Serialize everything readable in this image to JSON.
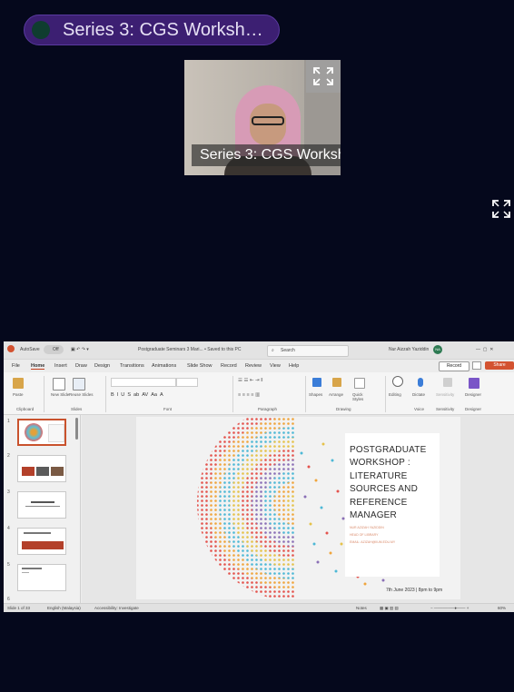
{
  "meeting": {
    "title": "Series 3: CGS Worksh…",
    "participant_label": "Series 3: CGS Worksh"
  },
  "powerpoint": {
    "autosave_label": "AutoSave",
    "autosave_state": "Off",
    "document_title": "Postgraduate Seminars 3 Mari... • Saved to this PC",
    "search_placeholder": "Search",
    "user_name": "Nur Aizzah Yaziddin",
    "user_initials": "NA",
    "menu": [
      "File",
      "Home",
      "Insert",
      "Draw",
      "Design",
      "Transitions",
      "Animations",
      "Slide Show",
      "Record",
      "Review",
      "View",
      "Help"
    ],
    "active_menu": "Home",
    "record_label": "Record",
    "share_label": "Share",
    "ribbon": {
      "paste": "Paste",
      "new_slide": "New Slide",
      "reuse_slides": "Reuse Slides",
      "shapes": "Shapes",
      "arrange": "Arrange",
      "quick_styles": "Quick Styles",
      "editing": "Editing",
      "dictate": "Dictate",
      "sensitivity": "Sensitivity",
      "designer": "Designer",
      "groups": [
        "Clipboard",
        "Slides",
        "Font",
        "Paragraph",
        "Drawing",
        "Voice",
        "Sensitivity",
        "Designer"
      ]
    },
    "thumbnail_numbers": [
      "1",
      "2",
      "3",
      "4",
      "5",
      "6"
    ],
    "slide": {
      "heading_lines": [
        "POSTGRADUATE",
        "WORKSHOP :",
        "LITERATURE",
        "SOURCES AND",
        "REFERENCE",
        "MANAGER"
      ],
      "presenter": "NUR AZIZAH YAZIDDIN",
      "role": "HEAD OF LIBRARY",
      "email": "EMAIL: AZIZAH@IIUM.EDU.MY",
      "date": "7th June 2023 | 8pm to 9pm"
    },
    "status": {
      "slide_counter": "Slide 1 of 33",
      "language": "English (Malaysia)",
      "accessibility": "Accessibility: Investigate",
      "notes": "Notes",
      "zoom": "60%"
    }
  },
  "colors": {
    "background": "#05081c",
    "title_pill": "#3c1f72",
    "ppt_accent": "#d35230"
  }
}
